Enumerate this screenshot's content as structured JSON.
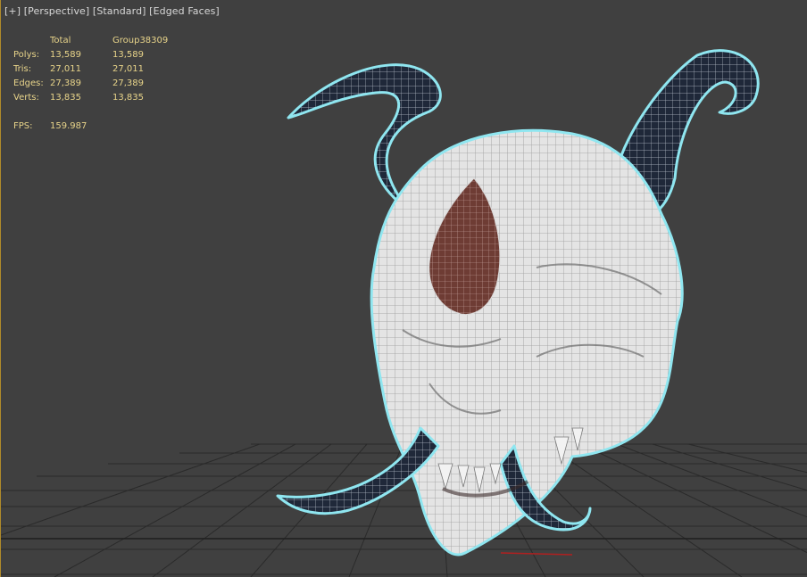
{
  "viewport": {
    "labels": [
      "[+]",
      "[Perspective]",
      "[Standard]",
      "[Edged Faces]"
    ],
    "selection_outline_color": "#8fe6f0",
    "mesh_fill_color": "#e6e6e6",
    "horn_color": "#1e2838",
    "eye_color": "#6e3c34"
  },
  "stats": {
    "header_total": "Total",
    "header_group": "Group38309",
    "rows": [
      {
        "label": "Polys:",
        "total": "13,589",
        "group": "13,589"
      },
      {
        "label": "Tris:",
        "total": "27,011",
        "group": "27,011"
      },
      {
        "label": "Edges:",
        "total": "27,389",
        "group": "27,389"
      },
      {
        "label": "Verts:",
        "total": "13,835",
        "group": "13,835"
      }
    ],
    "fps_label": "FPS:",
    "fps_value": "159.987"
  }
}
